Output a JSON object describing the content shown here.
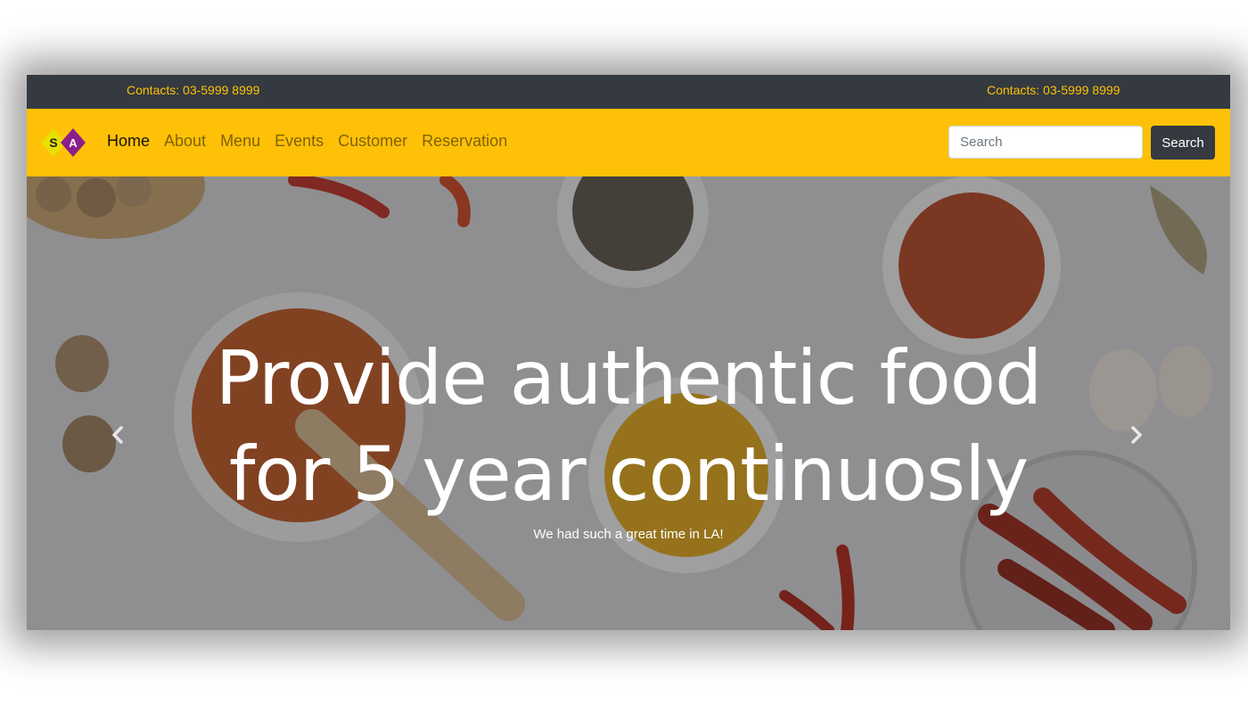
{
  "topbar": {
    "contact_left": "Contacts: 03-5999 8999",
    "contact_right": "Contacts: 03-5999 8999",
    "text_color": "#ffc107",
    "background": "#343a40"
  },
  "navbar": {
    "background": "#ffc107",
    "logo": {
      "letters": [
        "S",
        "A"
      ],
      "icon": "brand-logo-icon"
    },
    "items": [
      {
        "label": "Home",
        "active": true
      },
      {
        "label": "About",
        "active": false
      },
      {
        "label": "Menu",
        "active": false
      },
      {
        "label": "Events",
        "active": false
      },
      {
        "label": "Customer",
        "active": false
      },
      {
        "label": "Reservation",
        "active": false
      }
    ],
    "search": {
      "placeholder": "Search",
      "value": "",
      "button_label": "Search"
    }
  },
  "hero": {
    "title_line1": "Provide authentic food",
    "title_line2": "for 5 year continuosly",
    "caption": "We had such a great time in LA!",
    "prev_icon": "chevron-left-icon",
    "next_icon": "chevron-right-icon"
  }
}
